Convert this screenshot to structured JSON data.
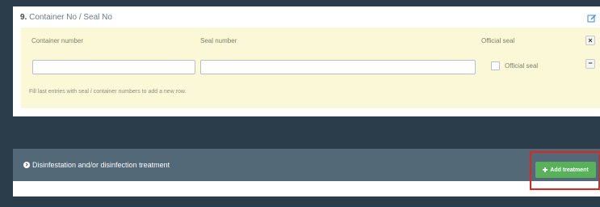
{
  "section": {
    "number": "9.",
    "title": "Container No / Seal No"
  },
  "table": {
    "headers": {
      "container_number": "Container number",
      "seal_number": "Seal number",
      "official_seal": "Official seal"
    },
    "close_label": "×",
    "remove_label": "−",
    "row": {
      "container_number": "",
      "seal_number": "",
      "official_seal_label": "Official seal",
      "official_seal_checked": false
    },
    "hint": "Fill last entries with seal / container numbers to add a new row."
  },
  "treatment": {
    "title": "Disinfestation and/or disinfection treatment",
    "add_button_label": "Add treatment"
  },
  "colors": {
    "page_background": "#2b3c4a",
    "yellow_panel": "#fbf8d8",
    "treatment_bar": "#546978",
    "add_button": "#59b15c",
    "highlight": "#e3261d",
    "edit_icon": "#3a8fd6"
  },
  "icons": {
    "edit": "edit-icon",
    "close": "close-icon",
    "minus": "minus-icon",
    "chevron": "chevron-circle-right-icon",
    "plus": "plus-icon"
  }
}
